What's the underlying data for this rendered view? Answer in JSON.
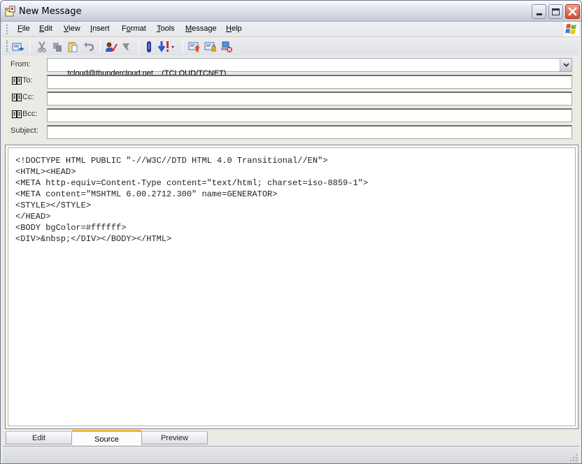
{
  "window": {
    "title": "New Message",
    "controls": {
      "minimize": "minimize",
      "maximize": "maximize",
      "close": "close"
    }
  },
  "menu": {
    "items": [
      {
        "label": "File",
        "accel": "F"
      },
      {
        "label": "Edit",
        "accel": "E"
      },
      {
        "label": "View",
        "accel": "V"
      },
      {
        "label": "Insert",
        "accel": "I"
      },
      {
        "label": "Format",
        "accel": "o"
      },
      {
        "label": "Tools",
        "accel": "T"
      },
      {
        "label": "Message",
        "accel": "M"
      },
      {
        "label": "Help",
        "accel": "H"
      }
    ]
  },
  "toolbar": {
    "buttons": [
      {
        "name": "send",
        "icon": "send-icon"
      },
      {
        "name": "cut",
        "icon": "scissors-icon"
      },
      {
        "name": "copy",
        "icon": "copy-icon"
      },
      {
        "name": "paste",
        "icon": "paste-icon"
      },
      {
        "name": "undo",
        "icon": "undo-icon"
      },
      {
        "name": "check-names",
        "icon": "check-names-icon"
      },
      {
        "name": "spelling",
        "icon": "spelling-icon"
      },
      {
        "name": "attach",
        "icon": "paperclip-icon"
      },
      {
        "name": "priority",
        "icon": "priority-icon"
      },
      {
        "name": "sign",
        "icon": "sign-certificate-icon"
      },
      {
        "name": "encrypt",
        "icon": "encrypt-lock-icon"
      },
      {
        "name": "work-offline",
        "icon": "offline-icon"
      }
    ]
  },
  "fields": {
    "from": {
      "label": "From:",
      "account": "tcloud@thundercloud.net",
      "account_detail": "(TCLOUD/TCNET)"
    },
    "to": {
      "label": "To:",
      "value": ""
    },
    "cc": {
      "label": "Cc:",
      "value": ""
    },
    "bcc": {
      "label": "Bcc:",
      "value": ""
    },
    "subject": {
      "label": "Subject:",
      "value": ""
    }
  },
  "editor": {
    "source_lines": [
      "<!DOCTYPE HTML PUBLIC \"-//W3C//DTD HTML 4.0 Transitional//EN\">",
      "<HTML><HEAD>",
      "<META http-equiv=Content-Type content=\"text/html; charset=iso-8859-1\">",
      "<META content=\"MSHTML 6.00.2712.300\" name=GENERATOR>",
      "<STYLE></STYLE>",
      "</HEAD>",
      "<BODY bgColor=#ffffff>",
      "<DIV>&nbsp;</DIV></BODY></HTML>"
    ]
  },
  "tabs": [
    {
      "label": "Edit",
      "active": false
    },
    {
      "label": "Source",
      "active": true
    },
    {
      "label": "Preview",
      "active": false
    }
  ],
  "colors": {
    "active_tab_accent": "#f1b03b",
    "close_button": "#d9492b"
  }
}
